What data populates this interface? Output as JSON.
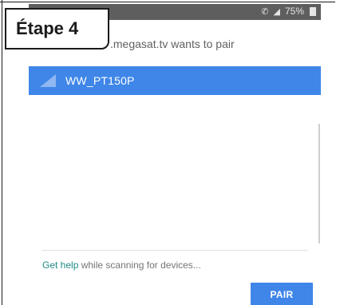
{
  "status_bar": {
    "battery_percent": "75%"
  },
  "dialog": {
    "title": ".megasat.tv wants to pair",
    "devices": [
      {
        "name": "WW_PT150P",
        "selected": true
      }
    ],
    "help_link": "Get help",
    "help_text": " while scanning for devices...",
    "pair_label": "PAIR"
  },
  "step_label": "Étape 4",
  "colors": {
    "accent": "#3f86e8",
    "link": "#1e8c85",
    "status_bar": "#5e5e5e"
  },
  "icons": {
    "signal": "signal-strength-icon",
    "wifi": "wifi-icon",
    "battery": "battery-icon"
  }
}
